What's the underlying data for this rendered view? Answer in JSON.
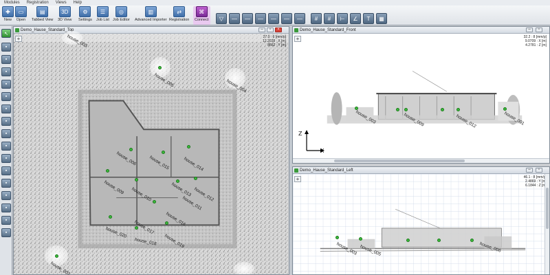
{
  "menubar": {
    "items": [
      "Modules",
      "Registration",
      "Views",
      "Help"
    ]
  },
  "ribbon": {
    "buttons": [
      {
        "label": "New",
        "icon": "new-icon"
      },
      {
        "label": "Open",
        "icon": "folder-icon"
      },
      {
        "label": "Tabbed View",
        "icon": "tabbed-view-icon"
      },
      {
        "label": "3D View",
        "icon": "3d-view-icon"
      },
      {
        "label": "Settings",
        "icon": "gear-icon"
      },
      {
        "label": "Job List",
        "icon": "job-list-icon"
      },
      {
        "label": "Job Editor",
        "icon": "job-editor-icon"
      },
      {
        "label": "Advanced Importer",
        "icon": "importer-icon"
      },
      {
        "label": "Registration",
        "icon": "registration-icon"
      },
      {
        "label": "Connect",
        "icon": "connect-icon"
      }
    ],
    "tool_icons": [
      "filter-icon",
      "line-tool-icon",
      "line-tool-icon",
      "line-tool-icon",
      "line-tool-icon",
      "line-tool-icon",
      "line-tool-icon",
      "grid-icon",
      "grid-icon",
      "measure-icon",
      "angle-icon",
      "text-tool-icon",
      "layers-icon"
    ]
  },
  "panels": {
    "top": {
      "title": "Demo_Hause_Standard_Top",
      "readout": [
        "27.0 : 6 [mm/p]",
        "12.2028 : X [m]",
        "8562 : Y [m]"
      ]
    },
    "front": {
      "title": "Demo_Hause_Standard_Front",
      "readout": [
        "32.2 : 8 [mm/p]",
        "9.0709 : X [m]",
        "4.2781 : Z [m]"
      ],
      "axes": {
        "z": "Z",
        "x": "X"
      }
    },
    "left": {
      "title": "Demo_Hause_Standard_Left",
      "readout": [
        "46.1 : 8 [mm/p]",
        "2.4869 : Y [m]",
        "6.1844 : Z [m]"
      ]
    }
  },
  "top_markers": [
    "house_003",
    "house_005",
    "house_004",
    "house_006",
    "house_015",
    "house_014",
    "house_009",
    "house_010",
    "house_013",
    "house_012",
    "house_011",
    "house_016",
    "house_017",
    "house_020",
    "house_018",
    "house_019",
    "house_002"
  ],
  "front_markers": [
    "house_003",
    "house_009",
    "house_012",
    "house_001"
  ],
  "left_markers": [
    "house_003",
    "house_005",
    "house_006"
  ],
  "colors": {
    "accent": "#3a9a3a",
    "active": "#9b3fb8",
    "marker": "#3dbb3d"
  }
}
